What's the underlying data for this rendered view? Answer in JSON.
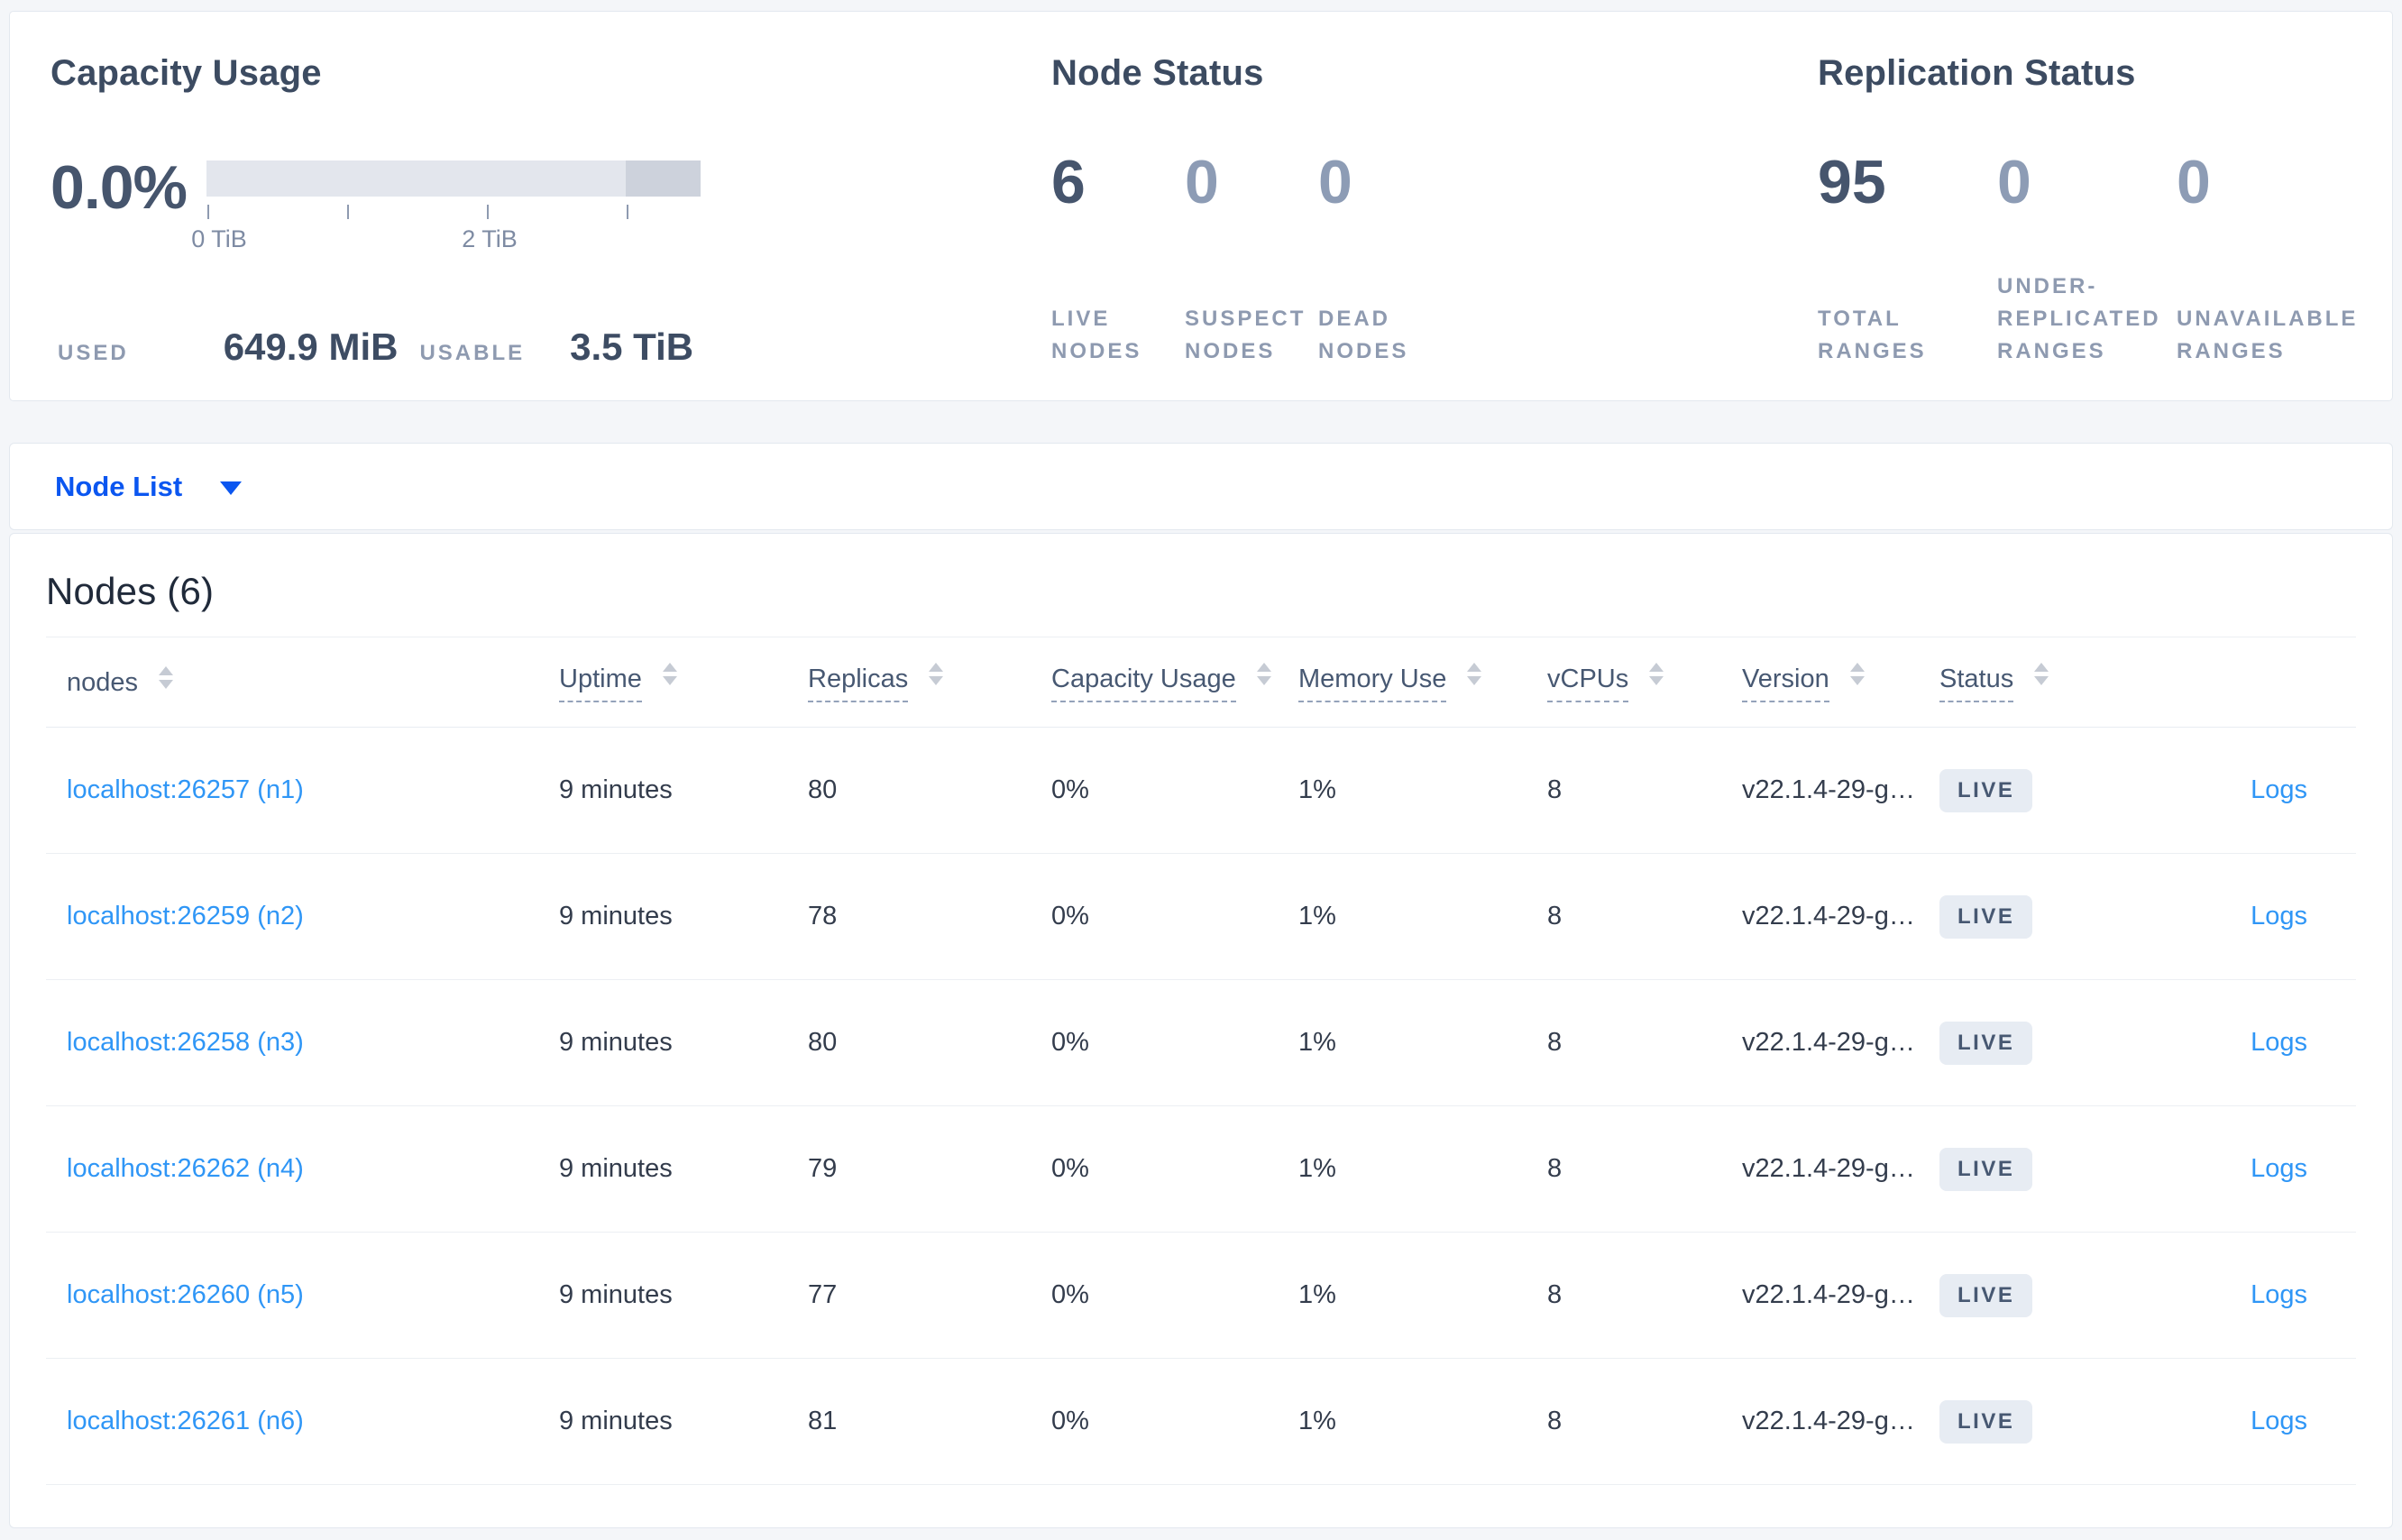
{
  "summary": {
    "capacity": {
      "title": "Capacity Usage",
      "percent": "0.0%",
      "axis": {
        "tick0": "0 TiB",
        "tick2": "2 TiB"
      },
      "used_label": "USED",
      "used_value": "649.9 MiB",
      "usable_label": "USABLE",
      "usable_value": "3.5 TiB"
    },
    "node_status": {
      "title": "Node Status",
      "stats": [
        {
          "value": "6",
          "label": "LIVE\nNODES"
        },
        {
          "value": "0",
          "label": "SUSPECT\nNODES"
        },
        {
          "value": "0",
          "label": "DEAD\nNODES"
        }
      ]
    },
    "replication": {
      "title": "Replication Status",
      "stats": [
        {
          "value": "95",
          "label": "TOTAL\nRANGES"
        },
        {
          "value": "0",
          "label": "UNDER-\nREPLICATED\nRANGES"
        },
        {
          "value": "0",
          "label": "UNAVAILABLE\nRANGES"
        }
      ]
    }
  },
  "nav": {
    "node_list_label": "Node List"
  },
  "nodes_panel": {
    "heading": "Nodes (6)",
    "columns": {
      "nodes": "nodes",
      "uptime": "Uptime",
      "replicas": "Replicas",
      "capacity": "Capacity Usage",
      "memory": "Memory Use",
      "vcpus": "vCPUs",
      "version": "Version",
      "status": "Status"
    },
    "rows": [
      {
        "host": "localhost:26257 (n1)",
        "uptime": "9 minutes",
        "replicas": "80",
        "capacity": "0%",
        "memory": "1%",
        "vcpus": "8",
        "version": "v22.1.4-29-g…",
        "status": "LIVE",
        "logs": "Logs"
      },
      {
        "host": "localhost:26259 (n2)",
        "uptime": "9 minutes",
        "replicas": "78",
        "capacity": "0%",
        "memory": "1%",
        "vcpus": "8",
        "version": "v22.1.4-29-g…",
        "status": "LIVE",
        "logs": "Logs"
      },
      {
        "host": "localhost:26258 (n3)",
        "uptime": "9 minutes",
        "replicas": "80",
        "capacity": "0%",
        "memory": "1%",
        "vcpus": "8",
        "version": "v22.1.4-29-g…",
        "status": "LIVE",
        "logs": "Logs"
      },
      {
        "host": "localhost:26262 (n4)",
        "uptime": "9 minutes",
        "replicas": "79",
        "capacity": "0%",
        "memory": "1%",
        "vcpus": "8",
        "version": "v22.1.4-29-g…",
        "status": "LIVE",
        "logs": "Logs"
      },
      {
        "host": "localhost:26260 (n5)",
        "uptime": "9 minutes",
        "replicas": "77",
        "capacity": "0%",
        "memory": "1%",
        "vcpus": "8",
        "version": "v22.1.4-29-g…",
        "status": "LIVE",
        "logs": "Logs"
      },
      {
        "host": "localhost:26261 (n6)",
        "uptime": "9 minutes",
        "replicas": "81",
        "capacity": "0%",
        "memory": "1%",
        "vcpus": "8",
        "version": "v22.1.4-29-g…",
        "status": "LIVE",
        "logs": "Logs"
      }
    ]
  },
  "colors": {
    "page_bg": "#f4f6f9",
    "panel_border": "#e3e8ef",
    "accent_blue": "#0b56f0",
    "link_blue": "#2f96f6",
    "stat_dark": "#46556d",
    "stat_light": "#8d9cb5",
    "muted_label": "#8e9ab0",
    "badge_bg": "#e7ecf3",
    "badge_text": "#475872",
    "bar_light": "#e3e6ed",
    "bar_dark": "#cdd2dc"
  }
}
